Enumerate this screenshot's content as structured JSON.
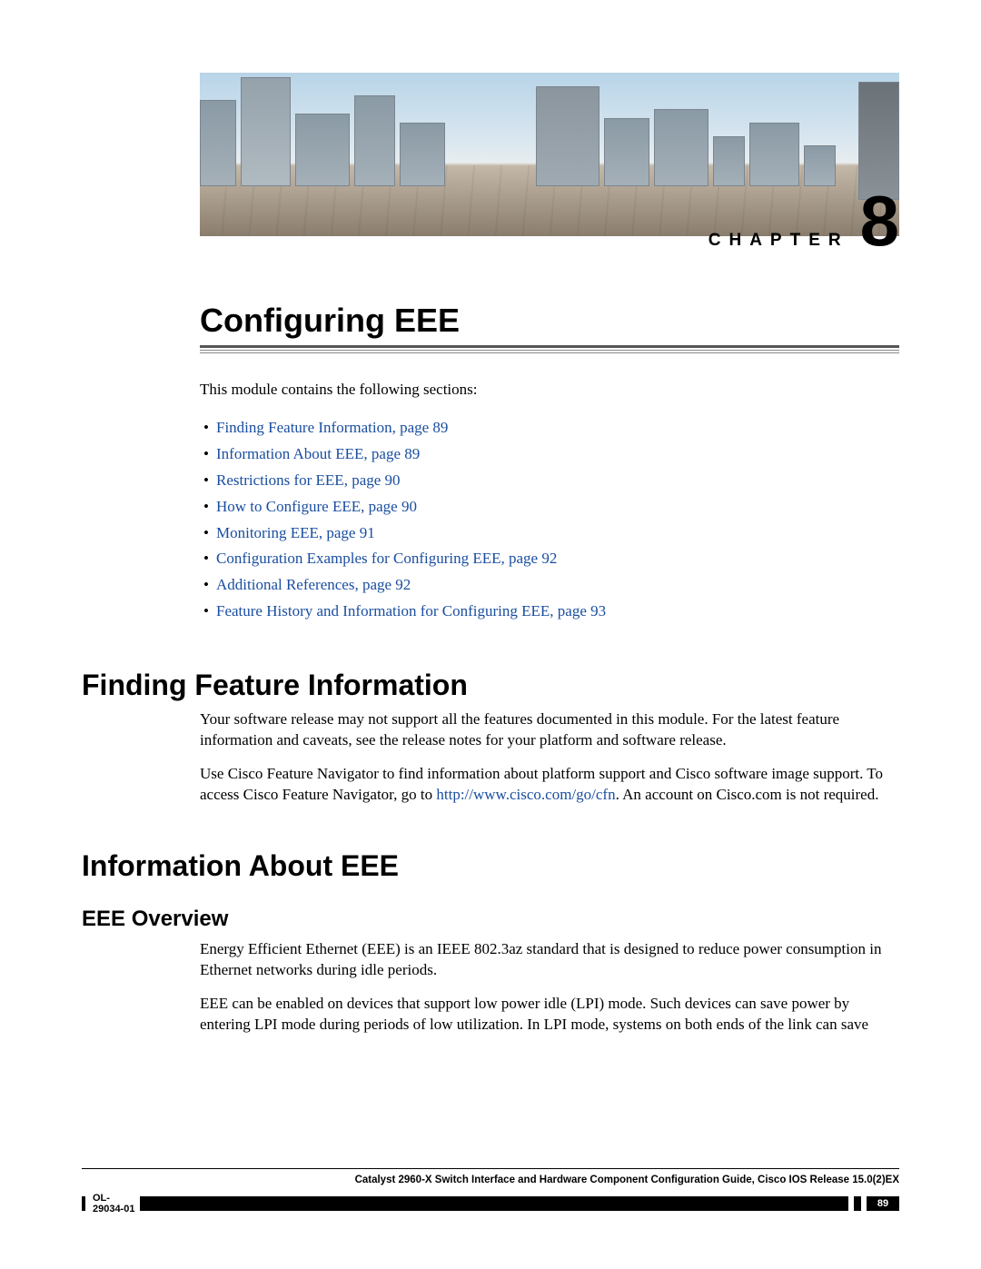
{
  "chapter": {
    "label": "CHAPTER",
    "number": "8"
  },
  "title": "Configuring EEE",
  "intro": "This module contains the following sections:",
  "toc": [
    "Finding Feature Information,  page  89",
    "Information About EEE,  page  89",
    "Restrictions for EEE,  page  90",
    "How to Configure EEE,  page  90",
    "Monitoring EEE,  page  91",
    "Configuration Examples for Configuring EEE,  page  92",
    "Additional References,  page  92",
    "Feature History and Information for Configuring EEE,  page  93"
  ],
  "sections": {
    "ffi": {
      "heading": "Finding Feature Information",
      "p1": "Your software release may not support all the features documented in this module. For the latest feature information and caveats, see the release notes for your platform and software release.",
      "p2a": "Use Cisco Feature Navigator to find information about platform support and Cisco software image support. To access Cisco Feature Navigator, go to ",
      "p2_link": "http://www.cisco.com/go/cfn",
      "p2b": ". An account on Cisco.com is not required."
    },
    "iae": {
      "heading": "Information About EEE",
      "sub": "EEE Overview",
      "p1": "Energy Efficient Ethernet (EEE) is an IEEE 802.3az standard that is designed to reduce power consumption in Ethernet networks during idle periods.",
      "p2": "EEE can be enabled on devices that support low power idle (LPI) mode. Such devices can save power by entering LPI mode during periods of low utilization. In LPI mode, systems on both ends of the link can save"
    }
  },
  "footer": {
    "title": "Catalyst 2960-X Switch Interface and Hardware Component Configuration Guide, Cisco IOS Release 15.0(2)EX",
    "docnum": "OL-29034-01",
    "page": "89"
  }
}
